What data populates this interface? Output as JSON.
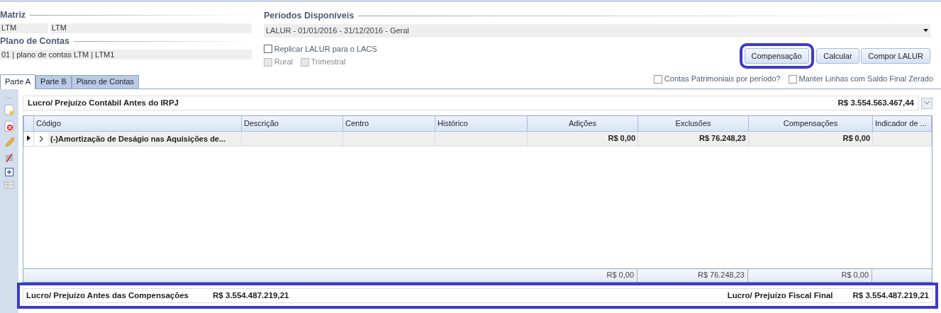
{
  "matriz": {
    "label": "Matriz",
    "code": "LTM",
    "name": "LTM"
  },
  "plano_de_contas": {
    "label": "Plano de Contas",
    "value": "01 | plano de contas LTM | LTM1"
  },
  "periodos": {
    "label": "Períodos Disponíveis",
    "value": "LALUR - 01/01/2016 - 31/12/2016 - Geral"
  },
  "options": [
    {
      "label": "Replicar LALUR para o LACS",
      "checked": false,
      "disabled": false
    },
    {
      "label": "Rural",
      "checked": false,
      "disabled": true
    },
    {
      "label": "Trimestral",
      "checked": false,
      "disabled": true
    }
  ],
  "buttons": [
    {
      "label": "Compensação",
      "highlighted": true
    },
    {
      "label": "Calcular"
    },
    {
      "label": "Compor LALUR"
    }
  ],
  "filters": [
    {
      "label": "Contas Patrimoniais por período?",
      "checked": false
    },
    {
      "label": "Manter Linhas com Saldo Final Zerado",
      "checked": false
    }
  ],
  "tabs": [
    {
      "label": "Parte A",
      "selected": true
    },
    {
      "label": "Parte B",
      "selected": false
    },
    {
      "label": "Plano de Contas",
      "selected": false
    }
  ],
  "summary": {
    "label": "Lucro/ Prejuízo Contábil Antes do IRPJ",
    "value": "R$ 3.554.563.467,44"
  },
  "table": {
    "columns": [
      {
        "label": "Código",
        "numeric": false
      },
      {
        "label": "Descrição",
        "numeric": false
      },
      {
        "label": "Centro",
        "numeric": false
      },
      {
        "label": "Histórico",
        "numeric": false
      },
      {
        "label": "Adições",
        "numeric": true,
        "total": "R$ 0,00"
      },
      {
        "label": "Exclusões",
        "numeric": true,
        "total": "R$ 76.248,23"
      },
      {
        "label": "Compensações",
        "numeric": true,
        "total": "R$ 0,00"
      },
      {
        "label": "Indicador de ...",
        "numeric": false
      }
    ],
    "rows": [
      {
        "selected": true,
        "expanded": false,
        "cells": [
          "(-)Amortização de Deságio nas Aquisições de...",
          null,
          null,
          null,
          "R$ 0,00",
          "R$ 76.248,23",
          "R$ 0,00",
          null
        ]
      }
    ]
  },
  "footer": {
    "highlighted": true,
    "items": [
      {
        "label": "Lucro/ Prejuízo Antes das Compensações",
        "value": "R$ 3.554.487.219,21"
      },
      {
        "label": "Lucro/ Prejuízo Fiscal Final",
        "value": "R$ 3.554.487.219,21"
      }
    ]
  }
}
